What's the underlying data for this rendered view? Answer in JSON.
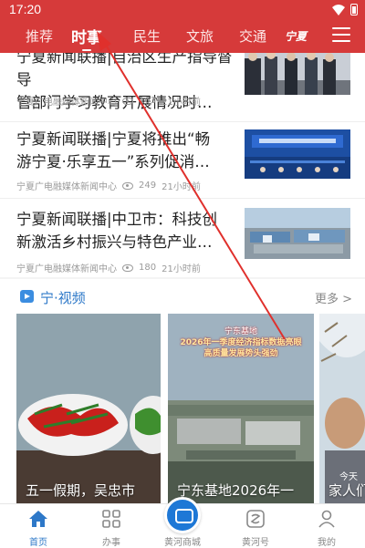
{
  "status": {
    "time": "17:20"
  },
  "nav": {
    "tabs": [
      "推荐",
      "时事",
      "民生",
      "文旅",
      "交通"
    ],
    "active_tab": "时事",
    "logo_text": "宁夏",
    "accent": "#d63a3a"
  },
  "articles": [
    {
      "title_line1": "宁夏新闻联播|自治区生产指导督导",
      "title_line2": "管部门学习教育开展情况时…",
      "source": "宁夏广电融媒体新闻中心",
      "views": "163",
      "time": "21小时前"
    },
    {
      "title_line1": "宁夏新闻联播|宁夏将推出“畅",
      "title_line2": "游宁夏·乐享五一”系列促消…",
      "source": "宁夏广电融媒体新闻中心",
      "views": "249",
      "time": "21小时前"
    },
    {
      "title_line1": "宁夏新闻联播|中卫市：科技创",
      "title_line2": "新激活乡村振兴与特色产业…",
      "source": "宁夏广电融媒体新闻中心",
      "views": "180",
      "time": "21小时前"
    }
  ],
  "video_section": {
    "title": "宁·视频",
    "more": "更多 >",
    "cards": [
      {
        "title": "五一假期，吴忠市"
      },
      {
        "title": "宁东基地2026年一",
        "overlay_top": "宁东基地",
        "overlay_line1": "2026年一季度经济指标数据亮眼",
        "overlay_line2": "高质量发展势头强劲"
      },
      {
        "title": "家人们",
        "overlay_text": "今天"
      }
    ]
  },
  "bottom_nav": {
    "items": [
      "首页",
      "办事",
      "黄河商城",
      "黄河号",
      "我的"
    ],
    "active": "首页",
    "accent": "#2d78c8"
  }
}
